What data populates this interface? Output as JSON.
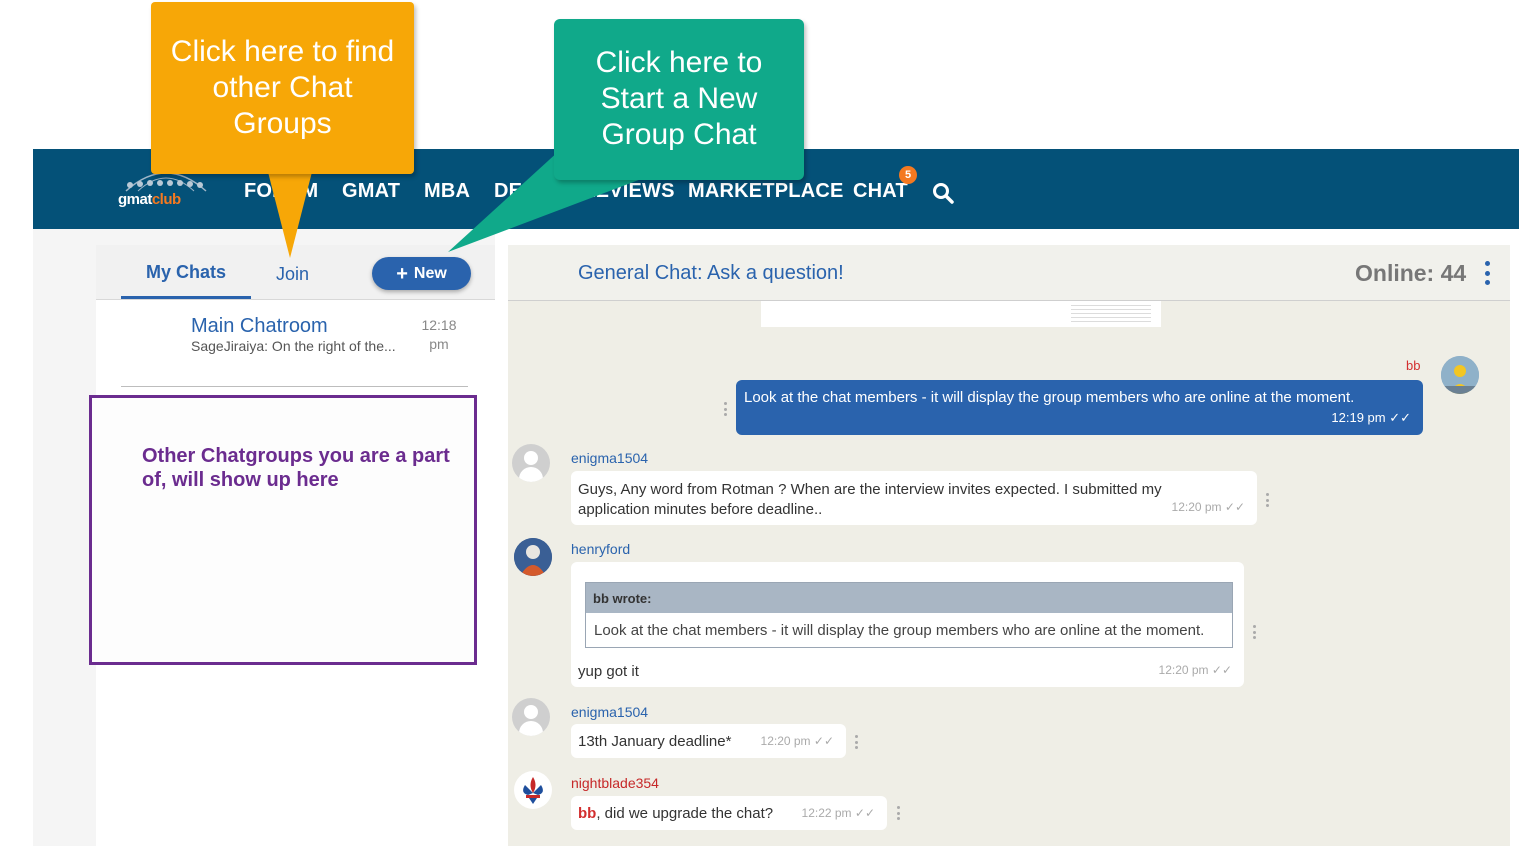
{
  "nav": {
    "logo_text_a": "gmat",
    "logo_text_b": "club",
    "items": [
      "FORUM",
      "GMAT",
      "MBA",
      "DEALS",
      "REVIEWS",
      "MARKETPLACE",
      "CHAT"
    ],
    "chat_badge": "5"
  },
  "callouts": {
    "orange": [
      "Click here to find",
      "other Chat",
      "Groups"
    ],
    "green": [
      "Click here to",
      "Start a New",
      "Group Chat"
    ],
    "info": "Other Chatgroups you are a part of, will show up here"
  },
  "left": {
    "tab_my_chats": "My Chats",
    "tab_join": "Join",
    "new_button": "New",
    "chats": [
      {
        "name": "Main Chatroom",
        "preview": "SageJiraiya: On the right of the...",
        "time_a": "12:18",
        "time_b": "pm"
      }
    ]
  },
  "chat": {
    "title": "General Chat: Ask a question!",
    "online": "Online: 44",
    "messages": [
      {
        "user": "bb",
        "text": "Look at the chat members - it will display the group members who are online at the moment.",
        "time": "12:19 pm ✓✓"
      },
      {
        "user": "enigma1504",
        "text_a": "Guys, Any word from Rotman ? When are the interview invites expected. I submitted my",
        "text_b": "application minutes before deadline..",
        "time": "12:20 pm ✓✓"
      },
      {
        "user": "henryford",
        "quote_head": "bb wrote:",
        "quote_body": "Look at the chat members - it will display the group members who are online at the moment.",
        "text": "yup got it",
        "time": "12:20 pm ✓✓"
      },
      {
        "user": "enigma1504",
        "text": "13th January deadline*",
        "time": "12:20 pm ✓✓"
      },
      {
        "user": "nightblade354",
        "mention": "bb",
        "text": ", did we upgrade the chat?",
        "time": "12:22 pm ✓✓"
      }
    ]
  },
  "colors": {
    "nav_bg": "#045178",
    "accent_blue": "#2a63ad",
    "orange_callout": "#f7a707",
    "green_callout": "#10a98a",
    "purple": "#6b2c8f",
    "badge_orange": "#f47920"
  }
}
